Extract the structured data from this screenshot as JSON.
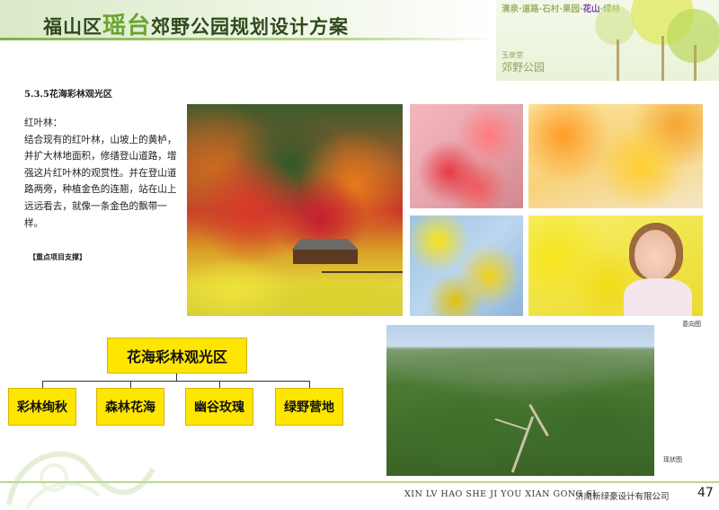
{
  "header": {
    "title_before": "福山区",
    "title_em": "瑶台",
    "title_after": "郊野公园规划设计方案"
  },
  "banner": {
    "tag_before": "清泉·道路·石村·果园·",
    "tag_highlight": "花山",
    "tag_after": "·绿林",
    "logo_small": "玉泉堂",
    "logo_big": "郊野公园"
  },
  "section": {
    "heading": "5.3.5花海彩林观光区",
    "subtitle": "红叶林：",
    "body": "结合现有的红叶林，山坡上的黄栌，并扩大林地面积，修缮登山道路，增强这片红叶林的观赏性。并在登山道路两旁，种植金色的连翘，站在山上远远看去，就像一条金色的飘带一样。",
    "note": "【重点项目支撑】"
  },
  "captions": {
    "intent": "意向图",
    "current": "现状图"
  },
  "diagram": {
    "root": "花海彩林观光区",
    "children": [
      "彩林绚秋",
      "森林花海",
      "幽谷玫瑰",
      "绿野营地"
    ]
  },
  "footer": {
    "pinyin": "XIN LV HAO SHE JI YOU XIAN GONG SI",
    "company": "济南新绿豪设计有限公司",
    "page": "47"
  },
  "colors": {
    "accent_green": "#6aa52f",
    "box_yellow": "#ffe600"
  }
}
